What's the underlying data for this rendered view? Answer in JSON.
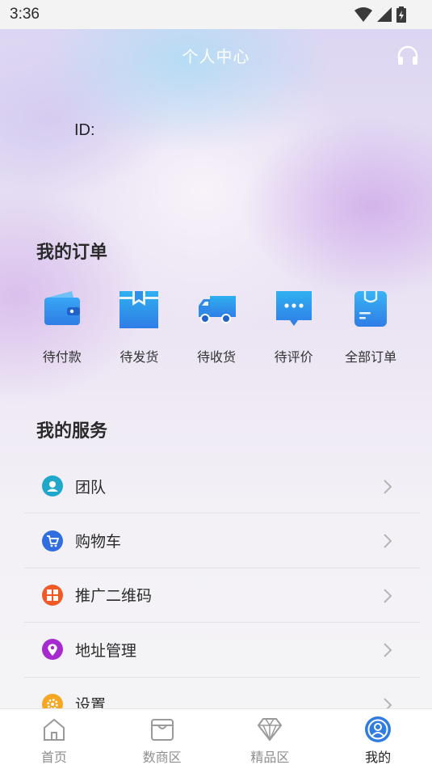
{
  "status_bar": {
    "time": "3:36"
  },
  "header": {
    "title": "个人中心"
  },
  "user": {
    "id_label": "ID:"
  },
  "orders": {
    "title": "我的订单",
    "items": [
      {
        "label": "待付款",
        "icon": "wallet-icon"
      },
      {
        "label": "待发货",
        "icon": "box-icon"
      },
      {
        "label": "待收货",
        "icon": "truck-icon"
      },
      {
        "label": "待评价",
        "icon": "chat-icon"
      },
      {
        "label": "全部订单",
        "icon": "bag-icon"
      }
    ]
  },
  "services": {
    "title": "我的服务",
    "items": [
      {
        "label": "团队",
        "icon": "team-icon",
        "color": "#1fa8c9"
      },
      {
        "label": "购物车",
        "icon": "cart-icon",
        "color": "#2f6de1"
      },
      {
        "label": "推广二维码",
        "icon": "qrcode-icon",
        "color": "#f05a28"
      },
      {
        "label": "地址管理",
        "icon": "location-icon",
        "color": "#a72ad1"
      },
      {
        "label": "设置",
        "icon": "settings-icon",
        "color": "#f5a623"
      }
    ]
  },
  "bottom_nav": {
    "items": [
      {
        "label": "首页",
        "icon": "home-icon"
      },
      {
        "label": "数商区",
        "icon": "store-icon"
      },
      {
        "label": "精品区",
        "icon": "diamond-icon"
      },
      {
        "label": "我的",
        "icon": "profile-icon",
        "active": true
      }
    ]
  },
  "colors": {
    "accent": "#3a8ee6",
    "active_nav": "#2f7de1"
  }
}
